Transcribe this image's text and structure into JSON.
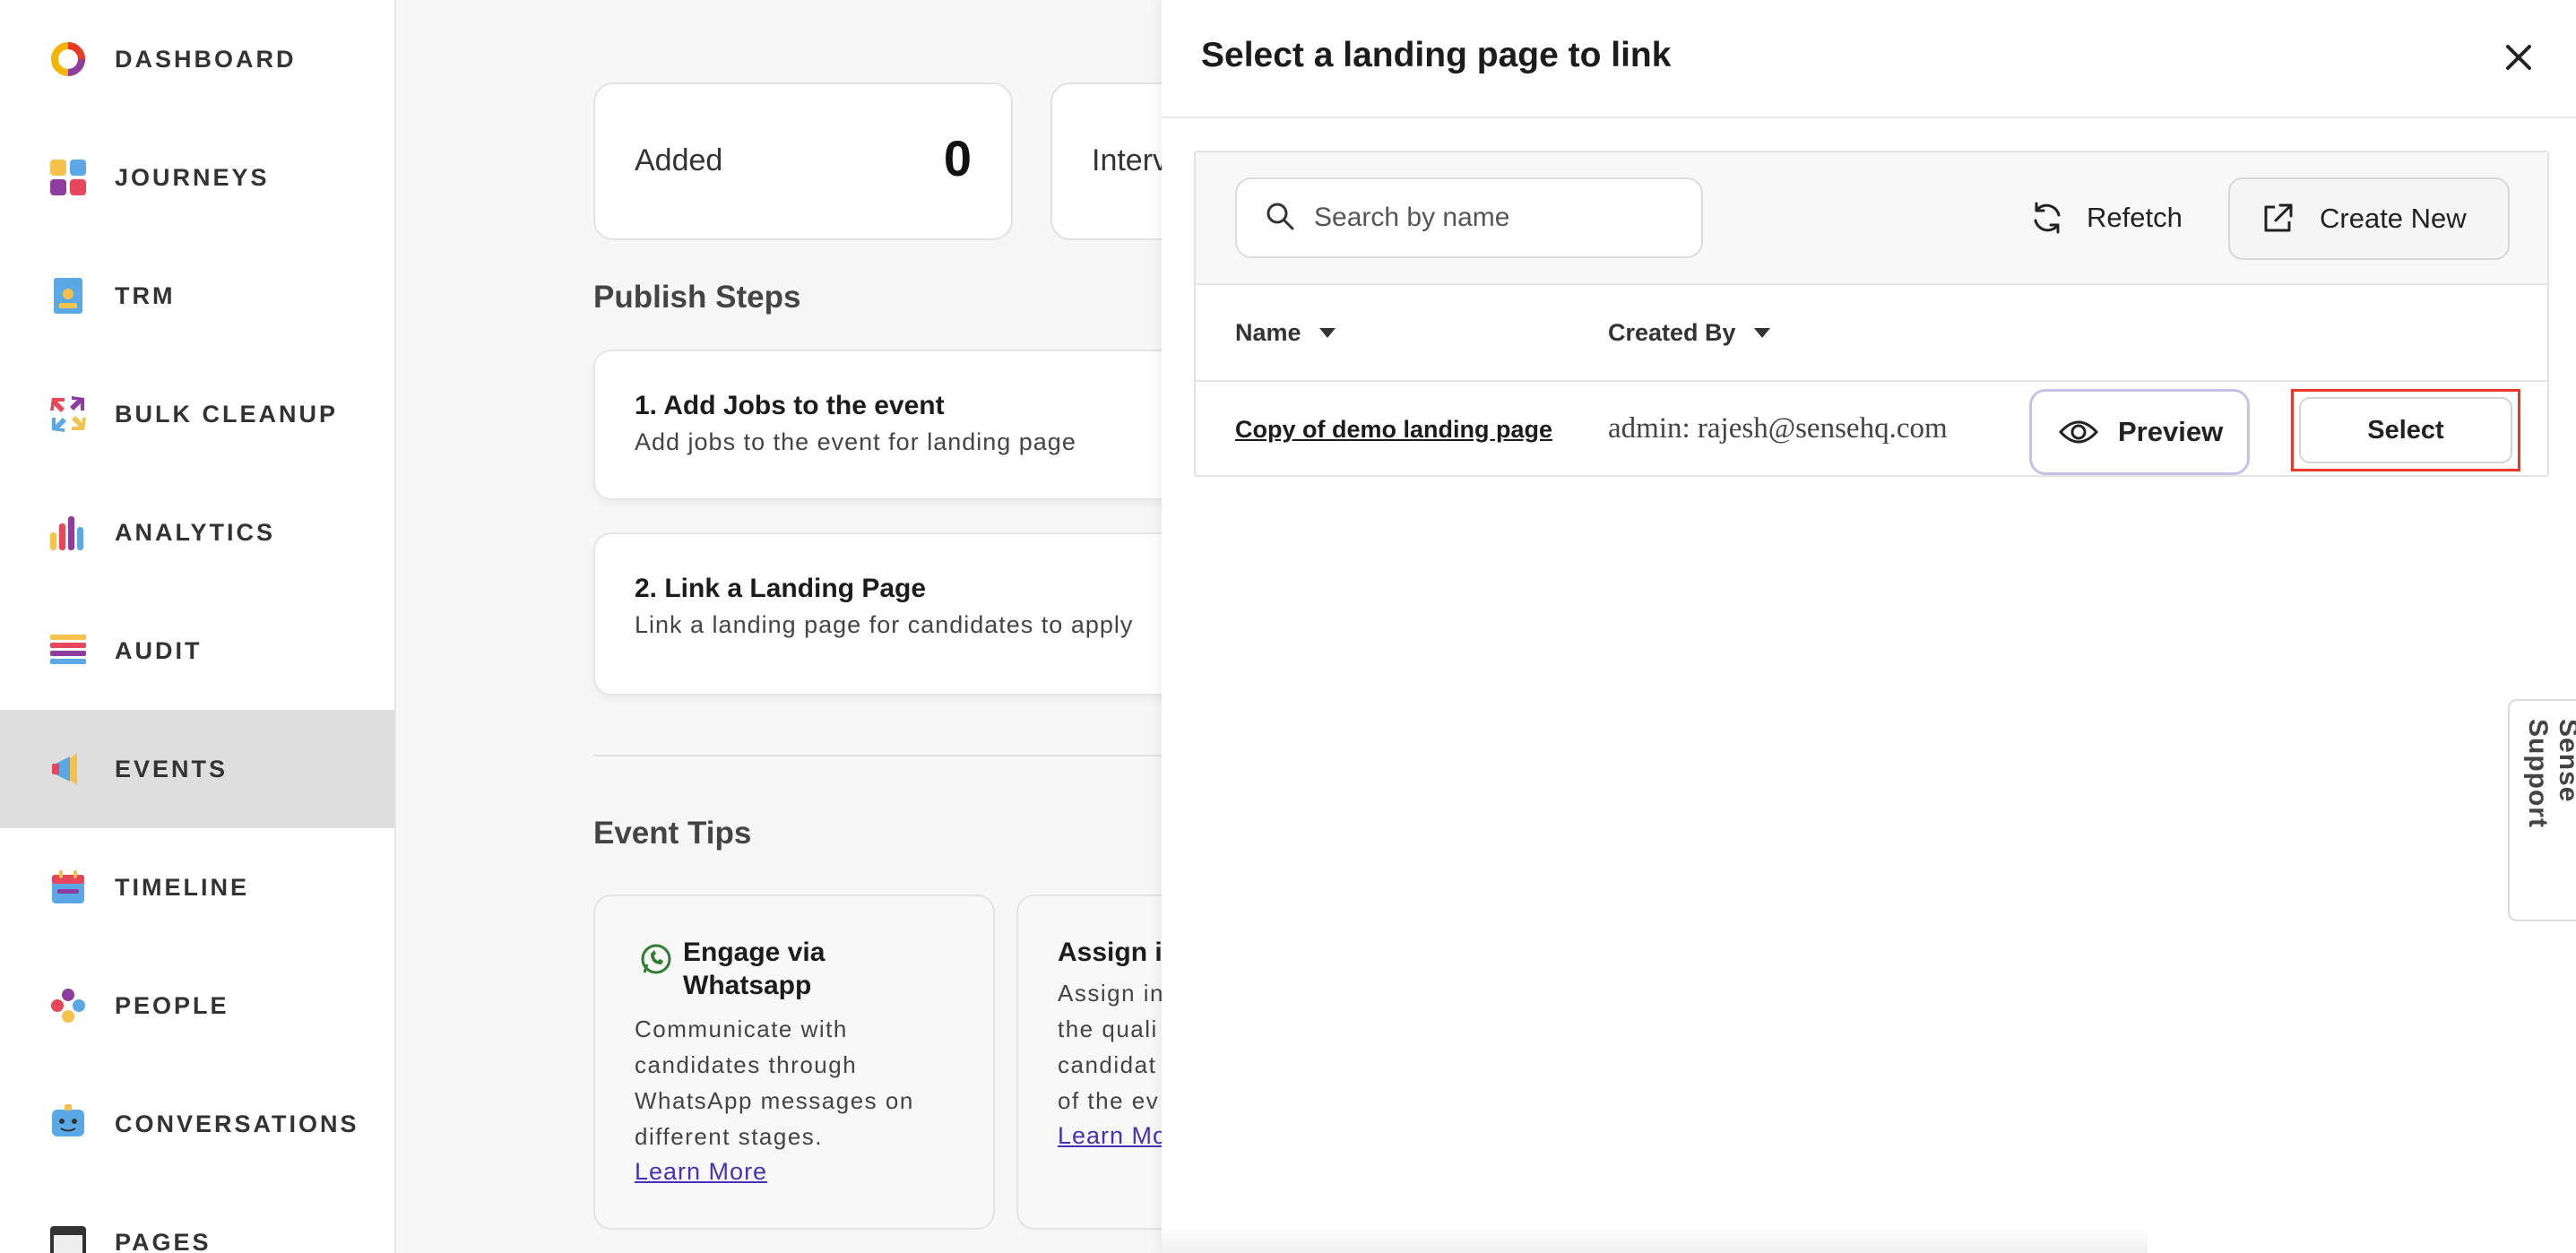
{
  "sidebar": {
    "items": [
      {
        "label": "DASHBOARD",
        "icon": "dashboard-ring-icon"
      },
      {
        "label": "JOURNEYS",
        "icon": "journeys-grid-icon"
      },
      {
        "label": "TRM",
        "icon": "trm-document-icon"
      },
      {
        "label": "BULK CLEANUP",
        "icon": "bulk-cleanup-arrows-icon"
      },
      {
        "label": "ANALYTICS",
        "icon": "analytics-bars-icon"
      },
      {
        "label": "AUDIT",
        "icon": "audit-list-icon"
      },
      {
        "label": "EVENTS",
        "icon": "events-megaphone-icon",
        "active": true
      },
      {
        "label": "TIMELINE",
        "icon": "timeline-calendar-icon"
      },
      {
        "label": "PEOPLE",
        "icon": "people-group-icon"
      },
      {
        "label": "CONVERSATIONS",
        "icon": "conversations-chat-icon"
      },
      {
        "label": "PAGES",
        "icon": "pages-browser-icon"
      }
    ]
  },
  "main": {
    "stats": [
      {
        "label": "Added",
        "value": "0"
      },
      {
        "label": "Interv",
        "value": ""
      }
    ],
    "publish_title": "Publish Steps",
    "steps": [
      {
        "title": "1. Add Jobs to the event",
        "desc": "Add jobs to the event for landing page"
      },
      {
        "title": "2. Link a Landing Page",
        "desc": "Link a landing page for candidates to apply"
      }
    ],
    "tips_title": "Event Tips",
    "tips": [
      {
        "title_line1": "Engage via",
        "title_line2": "Whatsapp",
        "body": [
          "Communicate with",
          "candidates through",
          "WhatsApp messages on",
          "different stages."
        ],
        "link": "Learn More"
      },
      {
        "title_line1": "Assign in",
        "body": [
          "Assign in",
          "the quali",
          "candidat",
          "of the ev"
        ],
        "link": "Learn Mo"
      }
    ]
  },
  "drawer": {
    "title": "Select a landing page to link",
    "search_placeholder": "Search by name",
    "refetch_label": "Refetch",
    "create_new_label": "Create New",
    "columns": {
      "name": "Name",
      "created_by": "Created By"
    },
    "rows": [
      {
        "name": "Copy of demo landing page",
        "created_by": "admin: rajesh@sensehq.com",
        "preview_label": "Preview",
        "select_label": "Select"
      }
    ]
  },
  "support_tab": "Sense Support",
  "colors": {
    "accent_purple": "#4632b8",
    "highlight_red": "#e8392a",
    "active_nav_bg": "#dedede"
  }
}
